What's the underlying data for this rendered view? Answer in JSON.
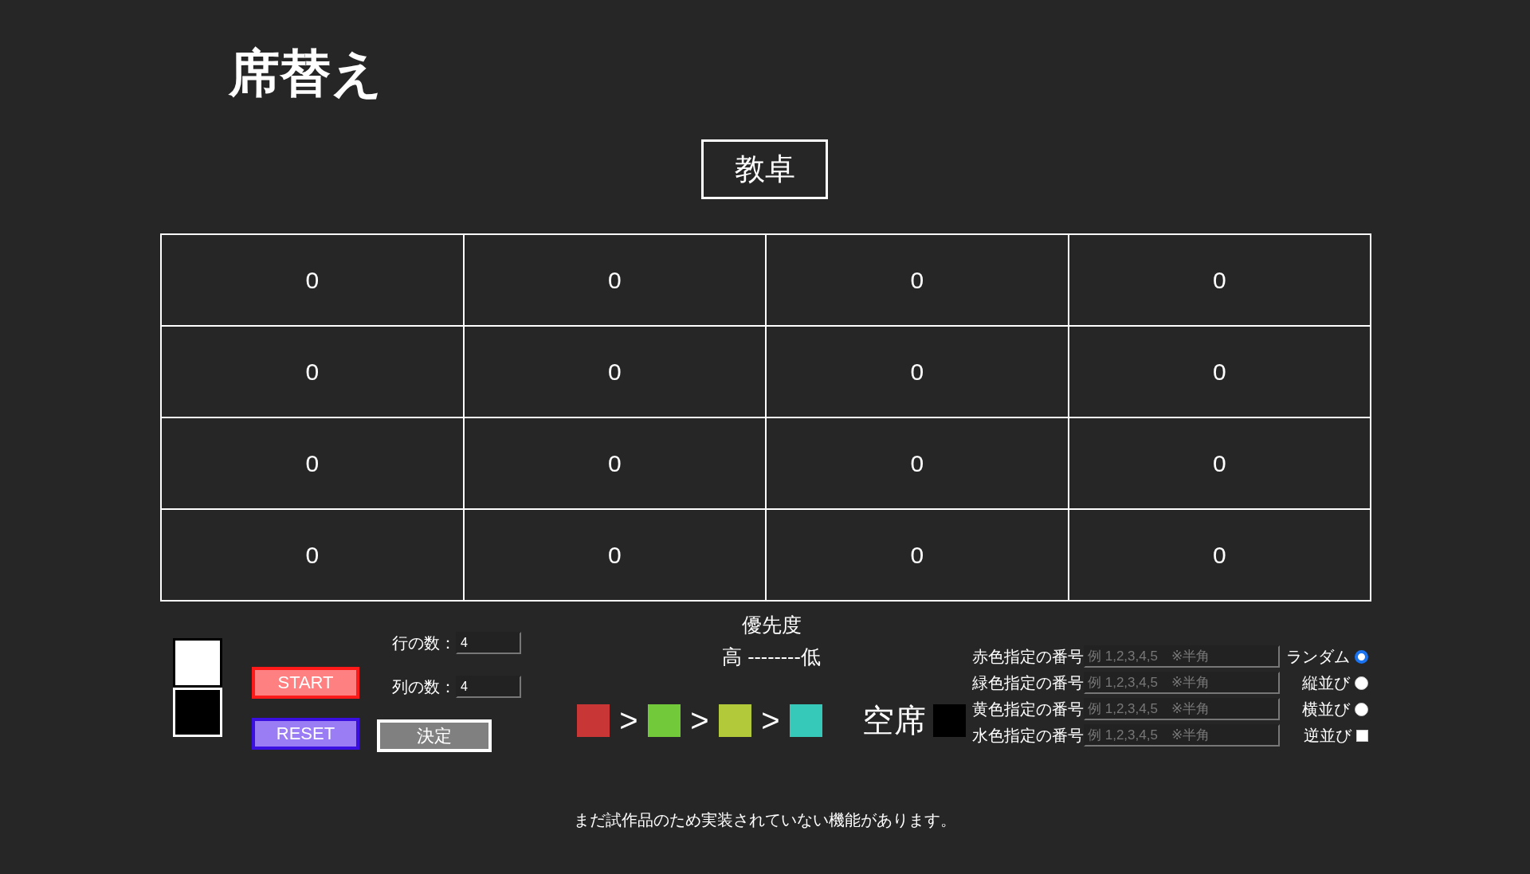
{
  "title": "席替え",
  "desk": "教卓",
  "seats": [
    [
      "0",
      "0",
      "0",
      "0"
    ],
    [
      "0",
      "0",
      "0",
      "0"
    ],
    [
      "0",
      "0",
      "0",
      "0"
    ],
    [
      "0",
      "0",
      "0",
      "0"
    ]
  ],
  "buttons": {
    "start": "START",
    "reset": "RESET",
    "confirm": "決定"
  },
  "size_fields": [
    {
      "label": "行の数：",
      "value": "4"
    },
    {
      "label": "列の数：",
      "value": "4"
    }
  ],
  "priority": {
    "title": "優先度",
    "scale": "高 --------低",
    "colors": [
      {
        "color": "#c93636"
      },
      {
        "color": "#72c93a"
      },
      {
        "color": "#b2c93a"
      },
      {
        "color": "#36c9b9"
      }
    ],
    "separator": ">"
  },
  "empty_seat": {
    "label": "空席",
    "color": "#000000"
  },
  "color_fields": [
    {
      "label": "赤色指定の番号",
      "placeholder": "例 1,2,3,4,5　※半角"
    },
    {
      "label": "緑色指定の番号",
      "placeholder": "例 1,2,3,4,5　※半角"
    },
    {
      "label": "黄色指定の番号",
      "placeholder": "例 1,2,3,4,5　※半角"
    },
    {
      "label": "水色指定の番号",
      "placeholder": "例 1,2,3,4,5　※半角"
    }
  ],
  "order_options": [
    {
      "label": "ランダム",
      "kind": "radio",
      "selected": true
    },
    {
      "label": "縦並び",
      "kind": "radio",
      "selected": false
    },
    {
      "label": "横並び",
      "kind": "radio",
      "selected": false
    },
    {
      "label": "逆並び",
      "kind": "checkbox",
      "checked": false
    }
  ],
  "footer": "まだ試作品のため実装されていない機能があります。"
}
